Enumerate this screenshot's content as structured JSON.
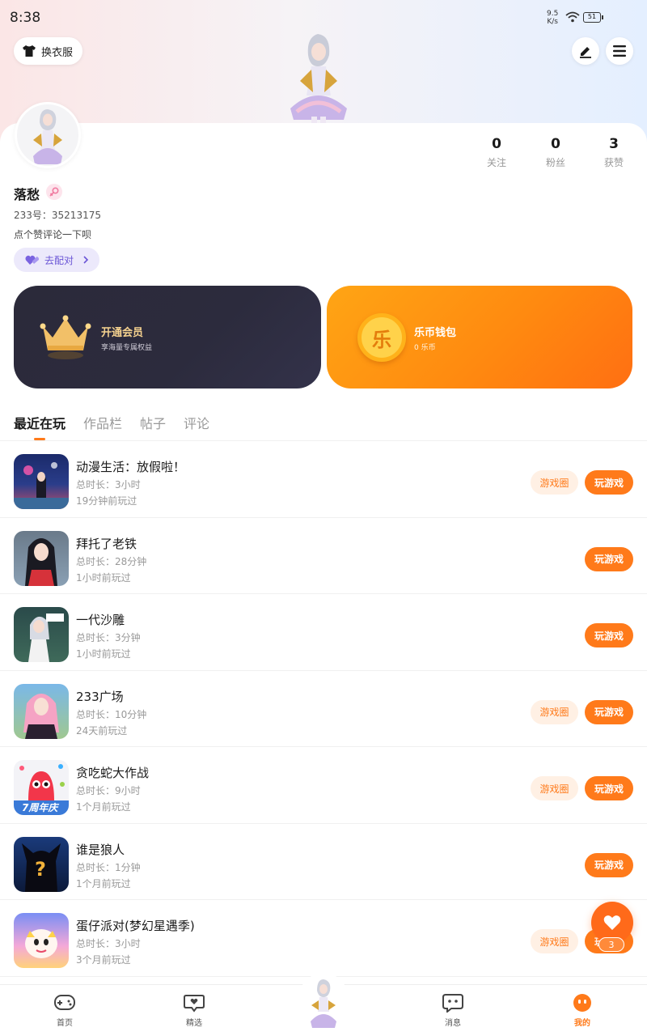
{
  "status_bar": {
    "time": "8:38",
    "net_speed_value": "9.5",
    "net_speed_unit": "K/s",
    "battery": "51"
  },
  "header": {
    "outfit_button": "换衣服"
  },
  "profile": {
    "username": "落愁",
    "uid": "233号：35213175",
    "bio": "点个赞评论一下呗",
    "match_button": "去配对",
    "stats": [
      {
        "value": "0",
        "label": "关注"
      },
      {
        "value": "0",
        "label": "粉丝"
      },
      {
        "value": "3",
        "label": "获赞"
      }
    ]
  },
  "cards": {
    "vip_title": "开通会员",
    "vip_subtitle": "享海量专属权益",
    "wallet_title": "乐币钱包",
    "wallet_subtitle": "0 乐币",
    "coin_glyph": "乐"
  },
  "tabs": [
    {
      "label": "最近在玩",
      "active": true
    },
    {
      "label": "作品栏",
      "active": false
    },
    {
      "label": "帖子",
      "active": false
    },
    {
      "label": "评论",
      "active": false
    }
  ],
  "buttons": {
    "game_circle": "游戏圈",
    "play": "玩游戏"
  },
  "games": [
    {
      "name": "动漫生活：放假啦！",
      "duration": "总时长：3小时",
      "last_played": "19分钟前玩过",
      "has_circle": true
    },
    {
      "name": "拜托了老铁",
      "duration": "总时长：28分钟",
      "last_played": "1小时前玩过",
      "has_circle": false
    },
    {
      "name": "一代沙雕",
      "duration": "总时长：3分钟",
      "last_played": "1小时前玩过",
      "has_circle": false
    },
    {
      "name": "233广场",
      "duration": "总时长：10分钟",
      "last_played": "24天前玩过",
      "has_circle": true
    },
    {
      "name": "贪吃蛇大作战",
      "duration": "总时长：9小时",
      "last_played": "1个月前玩过",
      "has_circle": true
    },
    {
      "name": "谁是狼人",
      "duration": "总时长：1分钟",
      "last_played": "1个月前玩过",
      "has_circle": false
    },
    {
      "name": "蛋仔派对(梦幻星遇季)",
      "duration": "总时长：3小时",
      "last_played": "3个月前玩过",
      "has_circle": true
    }
  ],
  "game_icon_text": {
    "snake_banner": "7周年庆",
    "werewolf_glyph": "?"
  },
  "fab": {
    "badge": "3"
  },
  "bottom_nav": [
    {
      "label": "首页",
      "icon": "gamepad-icon"
    },
    {
      "label": "精选",
      "icon": "heart-chat-icon"
    },
    {
      "label": "",
      "icon": "avatar-center"
    },
    {
      "label": "消息",
      "icon": "message-icon"
    },
    {
      "label": "我的",
      "icon": "profile-face-icon"
    }
  ],
  "colors": {
    "accent": "#ff7a1a",
    "vip_card": "#2b2a3a",
    "wallet_card": "#ff8a10",
    "match_purple": "#6a55d6"
  }
}
